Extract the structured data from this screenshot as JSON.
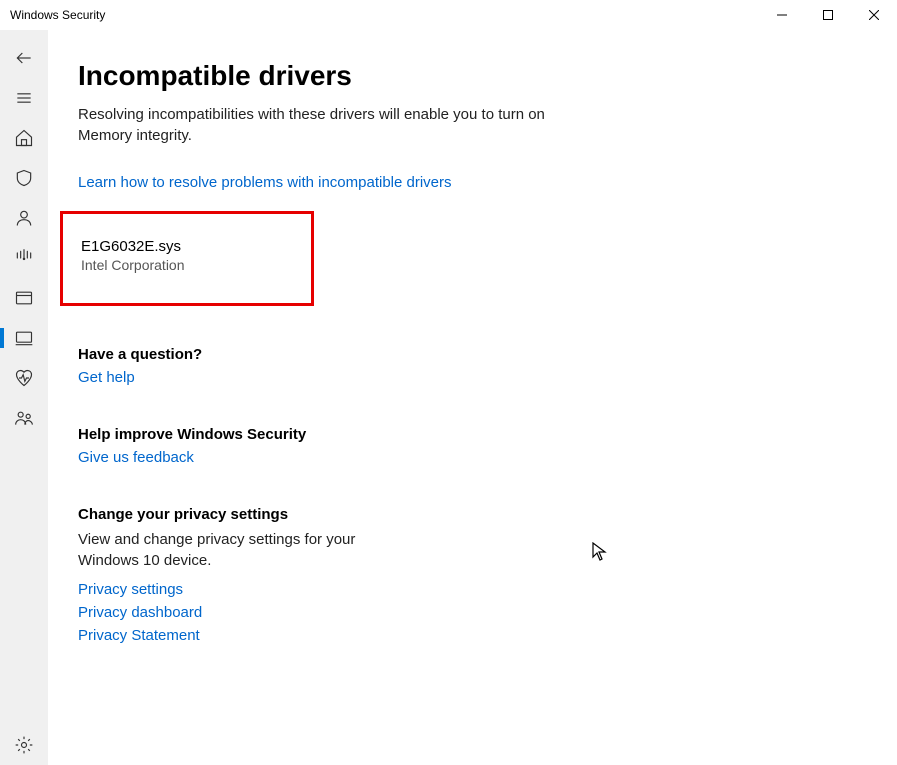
{
  "window": {
    "title": "Windows Security"
  },
  "page": {
    "title": "Incompatible drivers",
    "description": "Resolving incompatibilities with these drivers will enable you to turn on Memory integrity.",
    "learn_link": "Learn how to resolve problems with incompatible drivers"
  },
  "driver": {
    "filename": "E1G6032E.sys",
    "vendor": "Intel Corporation"
  },
  "question": {
    "heading": "Have a question?",
    "link": "Get help"
  },
  "improve": {
    "heading": "Help improve Windows Security",
    "link": "Give us feedback"
  },
  "privacy": {
    "heading": "Change your privacy settings",
    "body": "View and change privacy settings for your Windows 10 device.",
    "link1": "Privacy settings",
    "link2": "Privacy dashboard",
    "link3": "Privacy Statement"
  }
}
